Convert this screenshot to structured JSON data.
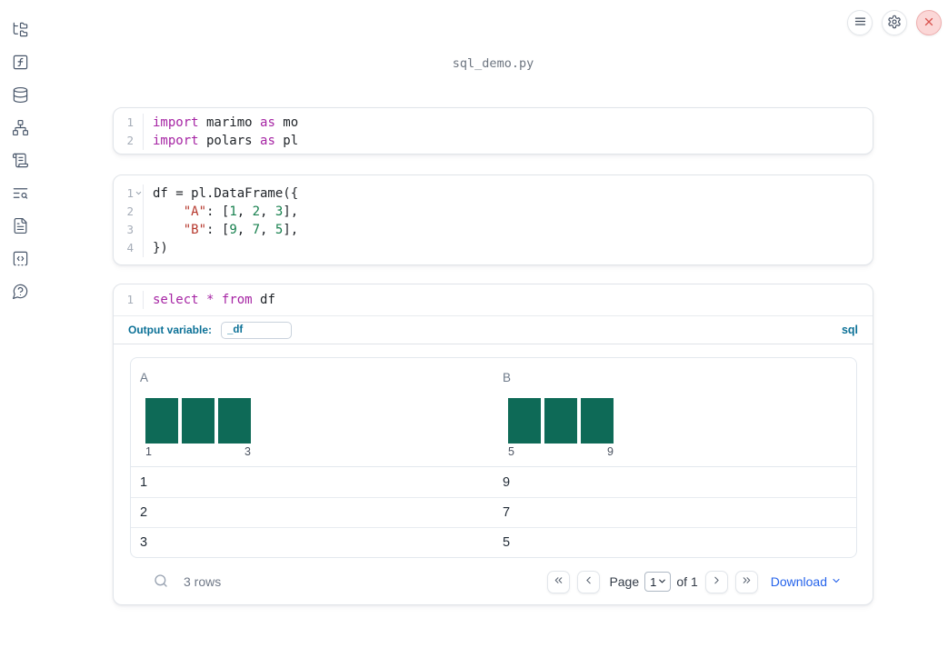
{
  "window": {
    "title": "sql_demo.py"
  },
  "topbar": {
    "buttons": [
      {
        "name": "notebook-menu",
        "icon": "hamburger-menu-icon"
      },
      {
        "name": "settings",
        "icon": "gear-icon"
      },
      {
        "name": "shutdown",
        "icon": "close-x-icon"
      }
    ]
  },
  "sidebar": {
    "items": [
      {
        "name": "file-explorer",
        "icon": "folder-tree-icon"
      },
      {
        "name": "variables",
        "icon": "function-square-icon"
      },
      {
        "name": "data-sources",
        "icon": "database-icon"
      },
      {
        "name": "dependencies",
        "icon": "network-graph-icon"
      },
      {
        "name": "logs",
        "icon": "scroll-text-icon"
      },
      {
        "name": "scratchpad",
        "icon": "text-search-icon"
      },
      {
        "name": "documentation",
        "icon": "file-text-icon"
      },
      {
        "name": "snippets",
        "icon": "code-square-dashed-icon"
      },
      {
        "name": "chat-help",
        "icon": "message-question-icon"
      }
    ]
  },
  "cells": [
    {
      "lines": [
        {
          "n": "1",
          "tokens": [
            {
              "t": "import",
              "c": "kw"
            },
            {
              "t": " marimo ",
              "c": "pl"
            },
            {
              "t": "as",
              "c": "kw"
            },
            {
              "t": " mo",
              "c": "pl"
            }
          ]
        },
        {
          "n": "2",
          "tokens": [
            {
              "t": "import",
              "c": "kw"
            },
            {
              "t": " polars ",
              "c": "pl"
            },
            {
              "t": "as",
              "c": "kw"
            },
            {
              "t": " pl",
              "c": "pl"
            }
          ]
        }
      ]
    },
    {
      "lines": [
        {
          "n": "1",
          "fold": true,
          "tokens": [
            {
              "t": "df = pl.DataFrame({",
              "c": "pl"
            }
          ]
        },
        {
          "n": "2",
          "tokens": [
            {
              "t": "    ",
              "c": "pl"
            },
            {
              "t": "\"A\"",
              "c": "str"
            },
            {
              "t": ": [",
              "c": "pl"
            },
            {
              "t": "1",
              "c": "num"
            },
            {
              "t": ", ",
              "c": "pl"
            },
            {
              "t": "2",
              "c": "num"
            },
            {
              "t": ", ",
              "c": "pl"
            },
            {
              "t": "3",
              "c": "num"
            },
            {
              "t": "],",
              "c": "pl"
            }
          ]
        },
        {
          "n": "3",
          "tokens": [
            {
              "t": "    ",
              "c": "pl"
            },
            {
              "t": "\"B\"",
              "c": "str"
            },
            {
              "t": ": [",
              "c": "pl"
            },
            {
              "t": "9",
              "c": "num"
            },
            {
              "t": ", ",
              "c": "pl"
            },
            {
              "t": "7",
              "c": "num"
            },
            {
              "t": ", ",
              "c": "pl"
            },
            {
              "t": "5",
              "c": "num"
            },
            {
              "t": "],",
              "c": "pl"
            }
          ]
        },
        {
          "n": "4",
          "tokens": [
            {
              "t": "})",
              "c": "pl"
            }
          ]
        }
      ]
    },
    {
      "lines": [
        {
          "n": "1",
          "tokens": [
            {
              "t": "select",
              "c": "kw"
            },
            {
              "t": " ",
              "c": "pl"
            },
            {
              "t": "*",
              "c": "kw"
            },
            {
              "t": " ",
              "c": "pl"
            },
            {
              "t": "from",
              "c": "kw"
            },
            {
              "t": " df",
              "c": "pl"
            }
          ]
        }
      ]
    }
  ],
  "sql_cell": {
    "output_variable_label": "Output variable:",
    "output_variable_value": "_df",
    "language_badge": "sql"
  },
  "table": {
    "columns": [
      {
        "header": "A",
        "hist_bars": [
          1,
          1,
          1
        ],
        "hist_labels": [
          "1",
          "3"
        ]
      },
      {
        "header": "B",
        "hist_bars": [
          1,
          1,
          1
        ],
        "hist_labels": [
          "5",
          "9"
        ]
      }
    ],
    "rows": [
      [
        "1",
        "9"
      ],
      [
        "2",
        "7"
      ],
      [
        "3",
        "5"
      ]
    ],
    "footer": {
      "row_count": "3 rows",
      "page_label": "Page",
      "page_value": "1",
      "of_label": "of 1",
      "download_label": "Download"
    }
  },
  "chart_data": [
    {
      "type": "bar",
      "title": "A",
      "categories": [
        "1",
        "2",
        "3"
      ],
      "values": [
        1,
        1,
        1
      ],
      "xlabel": "",
      "ylabel": "count",
      "note": "column summary histogram, equal bars, x-axis labels 1 and 3"
    },
    {
      "type": "bar",
      "title": "B",
      "categories": [
        "5",
        "7",
        "9"
      ],
      "values": [
        1,
        1,
        1
      ],
      "xlabel": "",
      "ylabel": "count",
      "note": "column summary histogram, equal bars, x-axis labels 5 and 9"
    }
  ],
  "colors": {
    "bar": "#0e6a57",
    "keyword": "#a625a4",
    "string": "#b6382d",
    "number": "#17804e",
    "sql_accent": "#0c7197",
    "link": "#2563eb",
    "close_danger": "#d9534f"
  }
}
